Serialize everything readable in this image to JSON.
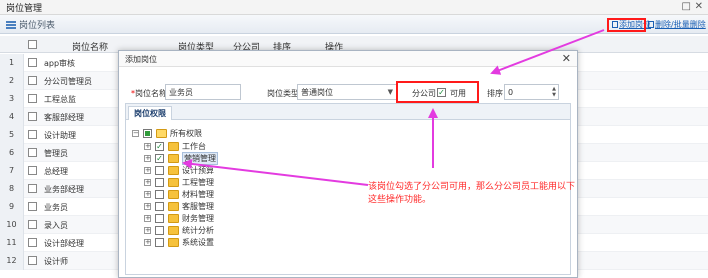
{
  "window": {
    "title": "岗位管理",
    "maximize_glyph": "□",
    "close_glyph": "✕"
  },
  "panel": {
    "title": "岗位列表",
    "add_label": "添加岗位",
    "delete_label": "删除/批量删除"
  },
  "grid": {
    "columns": [
      "岗位名称",
      "岗位类型",
      "分公司",
      "排序",
      "操作"
    ],
    "rows": [
      {
        "num": "1",
        "name": "app审核"
      },
      {
        "num": "2",
        "name": "分公司管理员"
      },
      {
        "num": "3",
        "name": "工程总监"
      },
      {
        "num": "4",
        "name": "客服部经理"
      },
      {
        "num": "5",
        "name": "设计助理"
      },
      {
        "num": "6",
        "name": "管理员"
      },
      {
        "num": "7",
        "name": "总经理"
      },
      {
        "num": "8",
        "name": "业务部经理"
      },
      {
        "num": "9",
        "name": "业务员"
      },
      {
        "num": "10",
        "name": "录入员"
      },
      {
        "num": "11",
        "name": "设计部经理"
      },
      {
        "num": "12",
        "name": "设计师"
      }
    ]
  },
  "dialog": {
    "title": "添加岗位",
    "close_glyph": "✕",
    "name_label": "岗位名称",
    "name_required_mark": "*",
    "name_value": "业务员",
    "type_label": "岗位类型",
    "type_value": "普通岗位",
    "branch_label": "分公司",
    "branch_checked": true,
    "branch_option": "可用",
    "sort_label": "排序",
    "sort_value": "0",
    "permissions_tab": "岗位权限",
    "tree": {
      "root": "所有权限",
      "children": [
        {
          "label": "工作台",
          "checked": true,
          "selected": false
        },
        {
          "label": "营销管理",
          "checked": true,
          "selected": true
        },
        {
          "label": "设计预算",
          "checked": false,
          "selected": false
        },
        {
          "label": "工程管理",
          "checked": false,
          "selected": false
        },
        {
          "label": "材料管理",
          "checked": false,
          "selected": false
        },
        {
          "label": "客服管理",
          "checked": false,
          "selected": false
        },
        {
          "label": "财务管理",
          "checked": false,
          "selected": false
        },
        {
          "label": "统计分析",
          "checked": false,
          "selected": false
        },
        {
          "label": "系统设置",
          "checked": false,
          "selected": false
        }
      ]
    }
  },
  "annotation": {
    "text": "该岗位勾选了分公司可用，那么分公司员工能用以下这些操作功能。",
    "color": "#ff2a2a"
  },
  "colors": {
    "highlight_box": "#ff1a1a",
    "arrow": "#e33be0",
    "link": "#1a5fb4",
    "check_green": "#1a8a3a"
  },
  "icons": {
    "folder": "folder-icon",
    "expand": "plus-icon",
    "list": "list-icon",
    "close": "close-icon",
    "maximize": "maximize-icon",
    "dropdown": "chevron-down-icon"
  }
}
